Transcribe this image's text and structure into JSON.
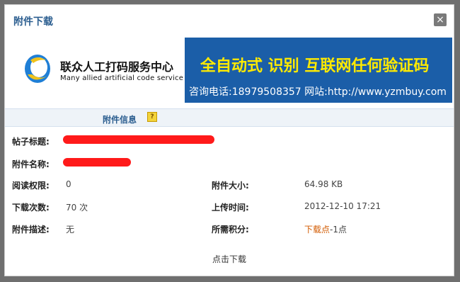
{
  "dialog": {
    "title": "附件下载",
    "close_glyph": "×"
  },
  "banner": {
    "brand_cn": "联众人工打码服务中心",
    "brand_en": "Many allied artificial code service",
    "headline": "全自动式 识别 互联网任何验证码",
    "contact": "咨询电话:18979508357  网站:http://www.yzmbuy.com"
  },
  "section": {
    "title": "附件信息",
    "help_glyph": "?"
  },
  "fields": {
    "post_title_label": "帖子标题:",
    "file_name_label": "附件名称:",
    "read_perm_label": "阅读权限:",
    "read_perm_value": "0",
    "size_label": "附件大小:",
    "size_value": "64.98 KB",
    "downloads_label": "下载次数:",
    "downloads_value": "70 次",
    "upload_time_label": "上传时间:",
    "upload_time_value": "2012-12-10 17:21",
    "desc_label": "附件描述:",
    "desc_value": "无",
    "points_label": "所需积分:",
    "points_highlight": "下载点",
    "points_value": "-1点"
  },
  "actions": {
    "download_label": "点击下载"
  },
  "colors": {
    "title_blue": "#2a5d8f",
    "banner_blue": "#1b5ea8",
    "headline_yellow": "#ffea00",
    "redact_red": "#ff1a1a",
    "highlight_orange": "#d25a00"
  }
}
